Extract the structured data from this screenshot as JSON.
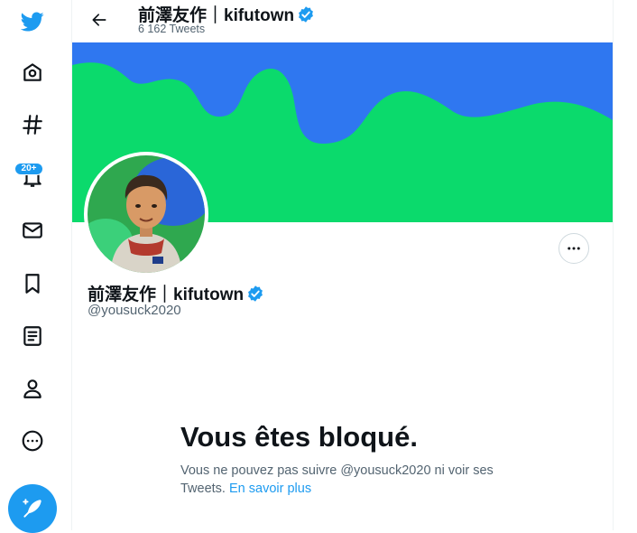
{
  "header": {
    "name": "前澤友作｜kifutown",
    "tweet_count": "6 162 Tweets"
  },
  "profile": {
    "name": "前澤友作｜kifutown",
    "handle": "@yousuck2020"
  },
  "nav": {
    "notifications_badge": "20+",
    "items": [
      "twitter-logo",
      "home-icon",
      "explore-icon",
      "notifications-icon",
      "messages-icon",
      "bookmarks-icon",
      "lists-icon",
      "profile-icon",
      "more-icon"
    ]
  },
  "blocked": {
    "title": "Vous êtes bloqué.",
    "message": "Vous ne pouvez pas suivre @yousuck2020 ni voir ses Tweets. ",
    "link": "En savoir plus"
  },
  "colors": {
    "accent": "#1d9bf0",
    "banner_green": "#0bda6c",
    "banner_blue": "#2f77f0"
  }
}
